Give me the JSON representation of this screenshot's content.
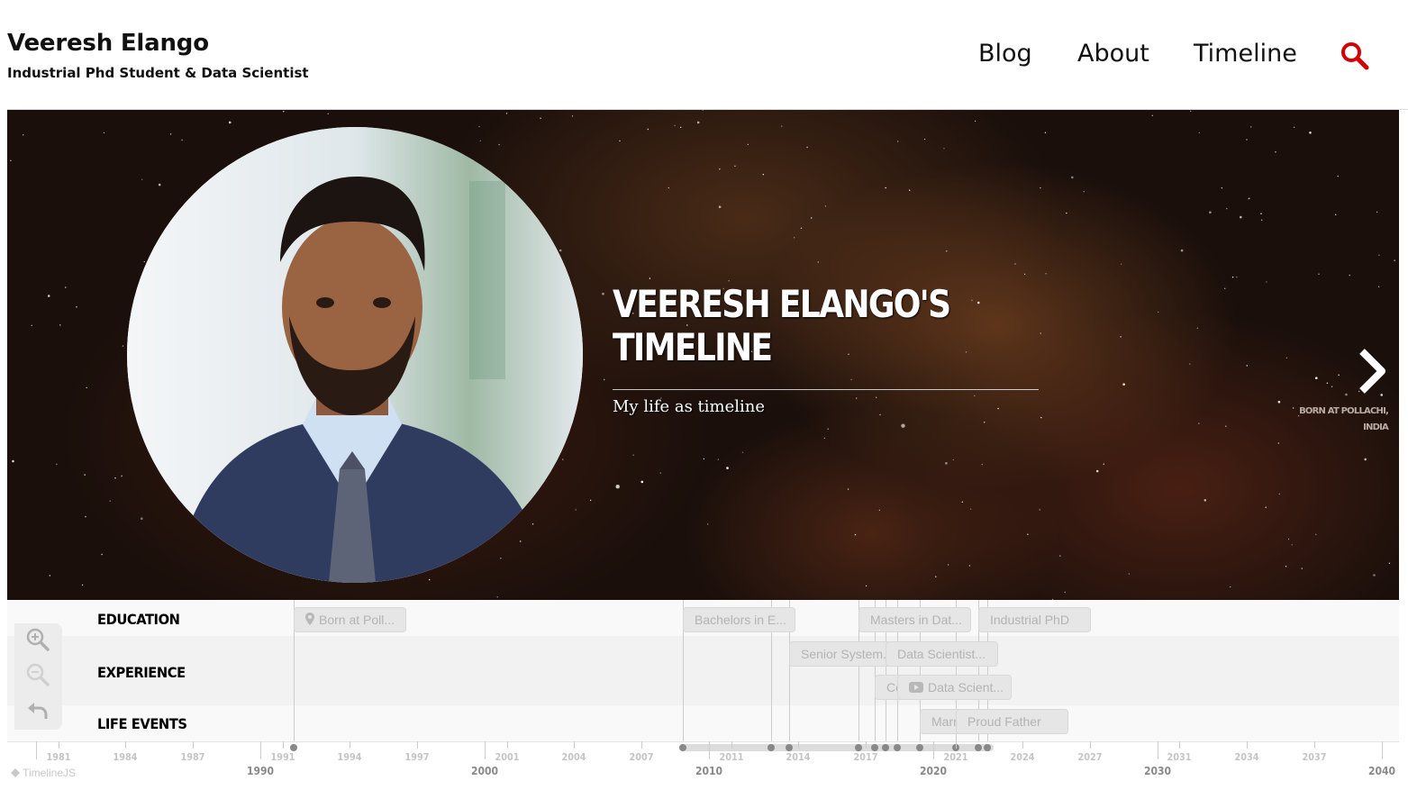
{
  "header": {
    "brand_name": "Veeresh Elango",
    "tagline": "Industrial Phd Student & Data Scientist",
    "nav": [
      "Blog",
      "About",
      "Timeline"
    ],
    "search_icon": "search-icon",
    "accent_color": "#d40000"
  },
  "hero": {
    "title_line1": "VEERESH ELANGO'S",
    "title_line2": "TIMELINE",
    "subtitle": "My life as timeline",
    "next_label_line1": "BORN AT POLLACHI,",
    "next_label_line2": "INDIA"
  },
  "timenav": {
    "groups": [
      "EDUCATION",
      "EXPERIENCE",
      "LIFE EVENTS"
    ],
    "markers": [
      {
        "label": "Born at Poll...",
        "icon": "map-pin-icon"
      },
      {
        "label": "Bachelors in E..."
      },
      {
        "label": "Masters in Dat..."
      },
      {
        "label": "Industrial PhD"
      },
      {
        "label": "Senior System..."
      },
      {
        "label": "Data Scientist..."
      },
      {
        "label": "Co"
      },
      {
        "label": "Data Scient...",
        "icon": "youtube-icon"
      },
      {
        "label": "Marr"
      },
      {
        "label": "Proud Father"
      }
    ],
    "minor_years": [
      "1981",
      "1984",
      "1987",
      "1991",
      "1994",
      "1997",
      "2001",
      "2004",
      "2007",
      "2011",
      "2014",
      "2017",
      "2021",
      "2024",
      "2027",
      "2031",
      "2034",
      "2037"
    ],
    "major_years": [
      "1990",
      "2000",
      "2010",
      "2020",
      "2030",
      "2040"
    ],
    "attribution": "TimelineJS"
  }
}
